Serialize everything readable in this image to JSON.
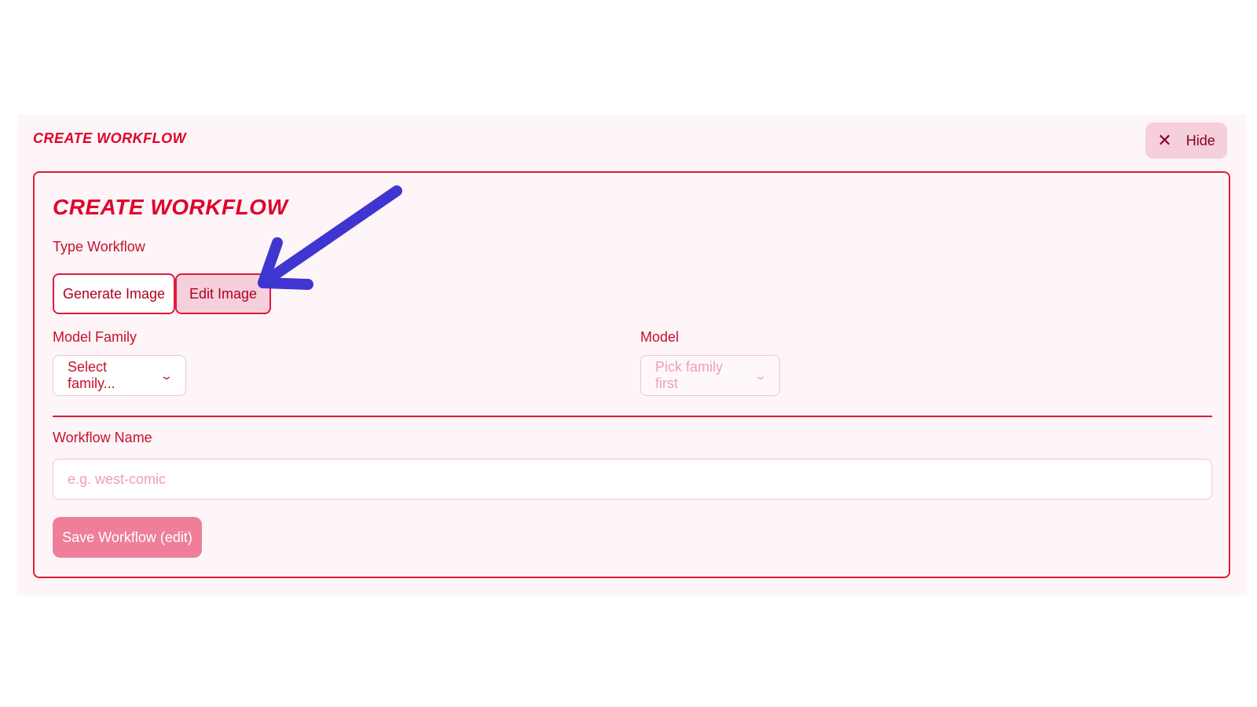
{
  "panel": {
    "title": "CREATE WORKFLOW",
    "hide_label": "Hide"
  },
  "card": {
    "title": "CREATE WORKFLOW",
    "type_label": "Type Workflow",
    "type_options": [
      "Generate Image",
      "Edit Image"
    ],
    "selected_type": "Edit Image",
    "model_family_label": "Model Family",
    "model_family_value": "Select family...",
    "model_label": "Model",
    "model_value": "Pick family first",
    "workflow_name_label": "Workflow Name",
    "workflow_name_placeholder": "e.g. west-comic",
    "workflow_name_value": "",
    "save_label": "Save Workflow (edit)"
  },
  "icons": {
    "hide": "close-icon",
    "select_chevron": "chevron-down-icon",
    "annotation": "arrow-annotation"
  },
  "colors": {
    "accent": "#e0002a",
    "border": "#e01a3c",
    "active_bg": "#f5cfdc",
    "save_bg": "#ef7e98",
    "arrow": "#3f35d0"
  }
}
